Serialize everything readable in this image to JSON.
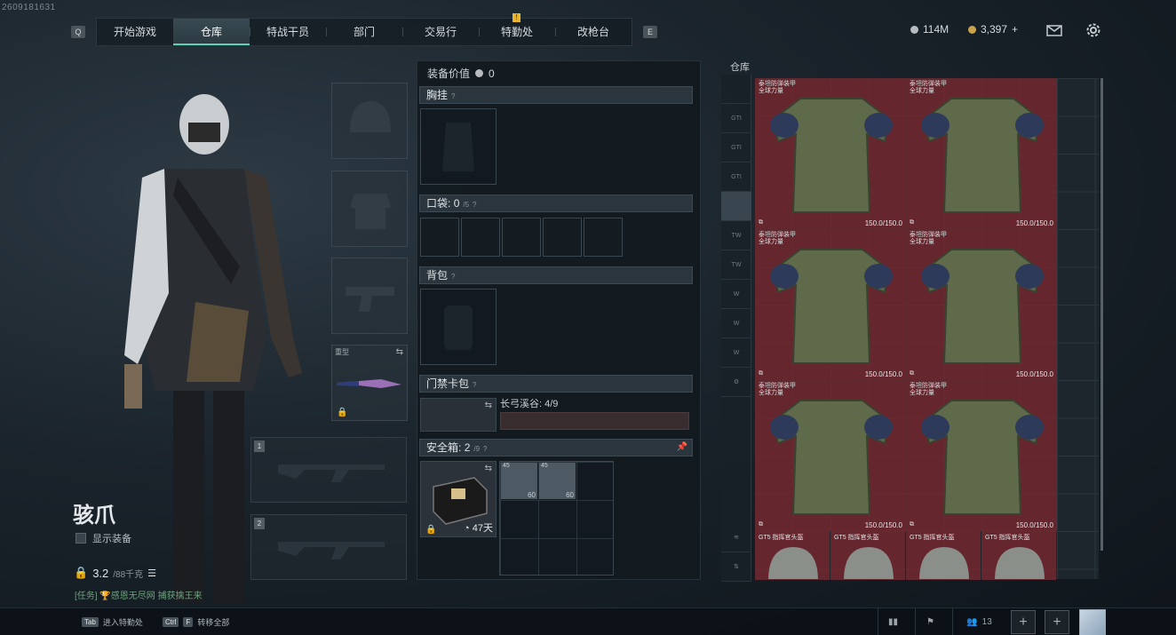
{
  "uid": "2609181631",
  "nav": {
    "left_key": "Q",
    "right_key": "E",
    "tabs": [
      {
        "label": "开始游戏"
      },
      {
        "label": "仓库"
      },
      {
        "label": "特战干员"
      },
      {
        "label": "部门"
      },
      {
        "label": "交易行"
      },
      {
        "label": "特勤处",
        "alert": "!"
      },
      {
        "label": "改枪台"
      }
    ],
    "active_tab": "仓库"
  },
  "currency": {
    "silver": "114M",
    "gold": "3,397",
    "gold_add": "+"
  },
  "character": {
    "name": "骇爪",
    "show_equipment_label": "显示装备",
    "weight": "3.2",
    "weight_max": "/88千克",
    "quest_text": "[任务] 🏆感恩无尽网  捕获擒王来"
  },
  "gear": {
    "melee_label": "重型"
  },
  "weapon_slots": [
    "1",
    "2"
  ],
  "equipment": {
    "title": "装备价值",
    "value": "0",
    "chest_rig": "胸挂",
    "pockets": "口袋:",
    "pockets_count": "0",
    "pockets_cap": "/5",
    "backpack": "背包",
    "keycard": "门禁卡包",
    "keycard_map": "长弓溪谷: 4/9",
    "safe_box": "安全箱:",
    "safe_count": "2",
    "safe_cap": "/9",
    "safe_days": "47天",
    "ammo_items": [
      {
        "top": "45",
        "count": "60"
      },
      {
        "top": "45",
        "count": "60"
      }
    ]
  },
  "warehouse": {
    "title": "仓库",
    "sidebar": [
      "",
      "GTI",
      "GTI",
      "GTI",
      "",
      "TW",
      "TW",
      "W",
      "W",
      "W",
      ""
    ],
    "armors": [
      {
        "name": "泰坦防弹装甲\n全球力量",
        "durability": "150.0/150.0"
      },
      {
        "name": "泰坦防弹装甲\n全球力量",
        "durability": "150.0/150.0"
      },
      {
        "name": "泰坦防弹装甲\n全球力量",
        "durability": "150.0/150.0"
      },
      {
        "name": "泰坦防弹装甲\n全球力量",
        "durability": "150.0/150.0"
      },
      {
        "name": "泰坦防弹装甲\n全球力量",
        "durability": "150.0/150.0"
      },
      {
        "name": "泰坦防弹装甲\n全球力量",
        "durability": "150.0/150.0"
      }
    ],
    "helmets": [
      "GT5 指挥官头盔",
      "GT5 指挥官头盔",
      "GT5 指挥官头盔",
      "GT5 指挥官头盔"
    ]
  },
  "bottom": {
    "tab_key": "Tab",
    "tab_hint": "进入特勤处",
    "ctrl_key": "Ctrl",
    "f_key": "F",
    "transfer_hint": "转移全部",
    "friends_count": "13"
  }
}
